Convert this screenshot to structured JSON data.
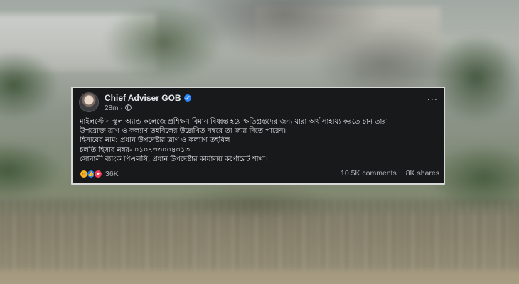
{
  "post": {
    "author": "Chief Adviser GOB",
    "time": "28m",
    "more_label": "···",
    "text_lines": [
      "মাইলস্টোন স্কুল অ্যান্ড কলেজে প্রশিক্ষণ বিমান বিধ্বস্ত হয়ে ক্ষতিগ্রস্তদের জন্য যারা অর্থ সাহায্য করতে চান তারা",
      "উপরোক্ত ত্রাণ ও কল্যাণ তহবিলের উল্লেখিত নম্বরে তা জমা দিতে পারেন।",
      "হিসাবের নাম: প্রধান উপদেষ্টার ত্রাণ ও কল্যাণ তহবিল",
      "চলতি হিসাব নম্বর- ০১০৭৩৩০০৪০১৩",
      "সোনালী ব্যাংক পিএলসি, প্রধান উপদেষ্টার কার্যালয় কর্পোরেট শাখা।"
    ],
    "reactions": {
      "icons": [
        "haha-icon",
        "like-icon",
        "love-icon"
      ],
      "count": "36K"
    },
    "comments": "10.5K comments",
    "shares": "8K shares"
  },
  "colors": {
    "card_bg": "#18191a",
    "text": "#e4e6eb",
    "muted": "#b0b3b8",
    "verified": "#2d88ff"
  }
}
